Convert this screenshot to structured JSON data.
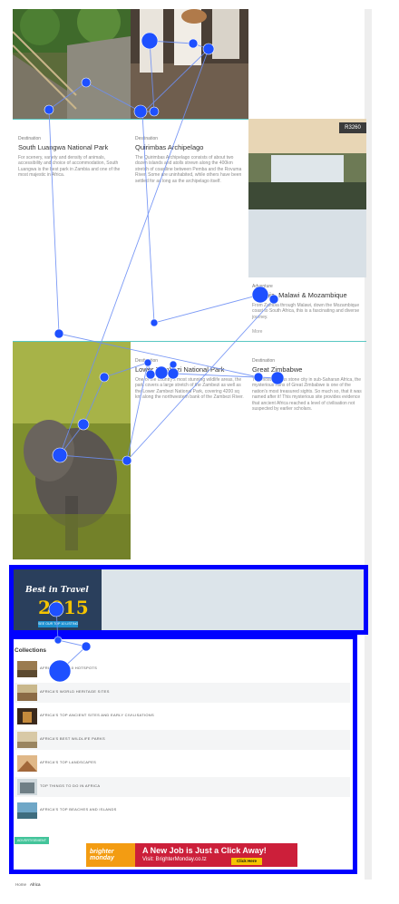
{
  "cards": [
    {
      "kicker": "Destination",
      "title": "South Luangwa National Park",
      "description": "For scenery, variety and density of animals, accessibility and choice of accommodation, South Luangwa is the best park in Zambia and one of the most majestic in Africa."
    },
    {
      "kicker": "Destination",
      "title": "Quirimbas Archipelago",
      "description": "The Quirimbas Archipelago consists of about two dozen islands and atolls strewn along the 400km stretch of coastline between Pemba and the Rovuma River. Some are uninhabited, while others have been settled for as long as the archipelago itself."
    },
    {
      "kicker": "Adventure",
      "title": "Zambia, Malawi & Mozambique",
      "description": "From Zambia through Malawi, down the Mozambique coast to South Africa, this is a fascinating and diverse journey.",
      "more": "More"
    },
    {
      "kicker": "Destination",
      "title": "Lower Zambezi National Park",
      "description": "One of the country's most stunning wildlife areas, the park covers a large stretch of the Zambezi as well as the Lower Zambezi National Park, covering 4200 sq km along the northwestern bank of the Zambezi River."
    },
    {
      "kicker": "Destination",
      "title": "Great Zimbabwe",
      "description": "The most famous stone city in sub-Saharan Africa, the mysterious ruins of Great Zimbabwe is one of the nation's most treasured sights. So much so, that it was named after it! This mysterious site provides evidence that ancient Africa reached a level of civilisation not suspected by earlier scholars."
    }
  ],
  "price_badge": "R3260",
  "promo": {
    "title": "Best in Travel",
    "year": "2015",
    "cta": "SEE OUR TOP 10 LISTINGS"
  },
  "collections": {
    "heading": "Collections",
    "items": [
      "AFRICA'S TOP 10 HOTSPOTS",
      "AFRICA'S WORLD HERITAGE SITES",
      "AFRICA'S TOP ANCIENT SITES AND EARLY CIVILISATIONS",
      "AFRICA'S BEST WILDLIFE PARKS",
      "AFRICA'S TOP LANDSCAPES",
      "TOP THINGS TO DO IN AFRICA",
      "AFRICA'S TOP BEACHES AND ISLANDS"
    ]
  },
  "advertisement": {
    "badge": "ADVERTISEMENT",
    "logo": "brighter monday",
    "headline": "A New Job is Just a Click Away!",
    "visit": "Visit: BrighterMonday.co.tz",
    "button": "Click Here"
  },
  "breadcrumb": {
    "home": "Home",
    "current": "Africa"
  },
  "colors": {
    "accent": "#59c7c2",
    "gaze": "#1e50ff",
    "highlight_box": "#0000ff"
  }
}
